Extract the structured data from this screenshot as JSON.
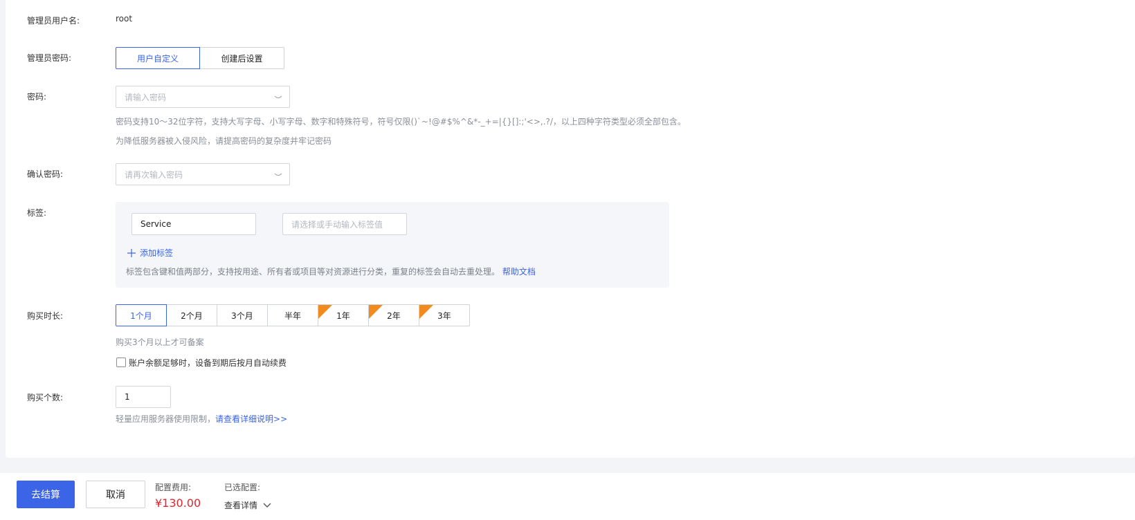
{
  "form": {
    "admin_username_label": "管理员用户名:",
    "admin_username_value": "root",
    "admin_password_label": "管理员密码:",
    "password_mode_options": [
      "用户自定义",
      "创建后设置"
    ],
    "password_mode_selected": "用户自定义",
    "password_label": "密码:",
    "password_placeholder": "请输入密码",
    "password_hint_1": "密码支持10～32位字符，支持大写字母、小写字母、数字和特殊符号，符号仅限()`~!@#$%^&*-_+=|{}[]:;'<>,.?/，以上四种字符类型必须全部包含。",
    "password_hint_2": "为降低服务器被入侵风险，请提高密码的复杂度并牢记密码",
    "confirm_password_label": "确认密码:",
    "confirm_password_placeholder": "请再次输入密码",
    "tags_label": "标签:",
    "tag_key_value": "Service",
    "tag_value_placeholder": "请选择或手动输入标签值",
    "add_tag_label": "添加标签",
    "tag_hint": "标签包含键和值两部分，支持按用途、所有者或项目等对资源进行分类，重复的标签会自动去重处理。",
    "help_doc_link": "帮助文档",
    "duration_label": "购买时长:",
    "duration_options": [
      "1个月",
      "2个月",
      "3个月",
      "半年",
      "1年",
      "2年",
      "3年"
    ],
    "duration_selected": "1个月",
    "duration_hint": "购买3个月以上才可备案",
    "auto_renew_label": "账户余额足够时，设备到期后按月自动续费",
    "auto_renew_checked": false,
    "quantity_label": "购买个数:",
    "quantity_value": "1",
    "quantity_hint": "轻量应用服务器使用限制，",
    "quantity_link": "请查看详细说明>>"
  },
  "footer": {
    "checkout_button": "去结算",
    "cancel_button": "取消",
    "config_fee_label": "配置费用:",
    "config_fee_value": "¥130.00",
    "selected_config_label": "已选配置:",
    "view_details_label": "查看详情"
  },
  "colors": {
    "accent": "#3b64e6",
    "price": "#e0262d",
    "ribbon": "#f28b1e"
  }
}
